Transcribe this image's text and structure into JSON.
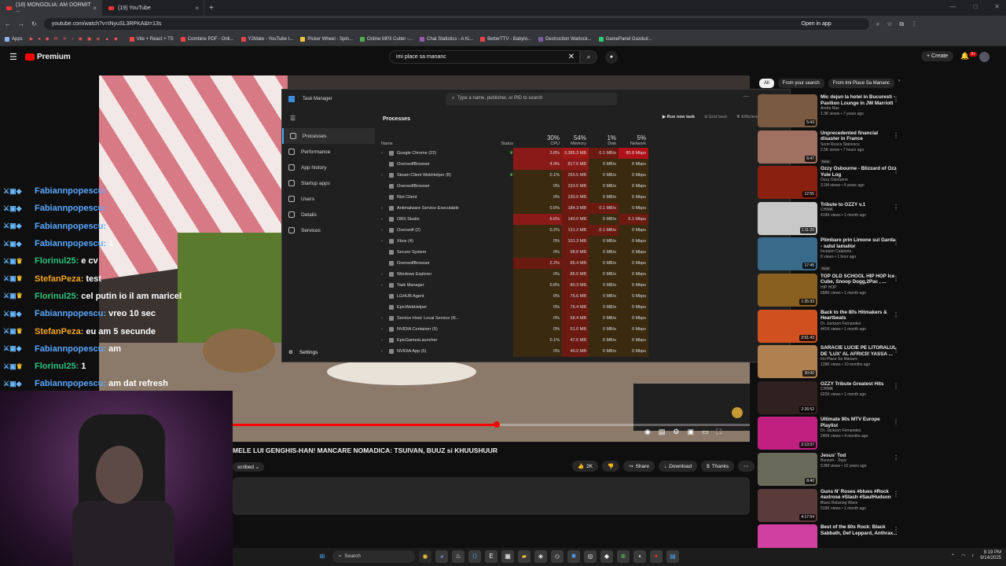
{
  "browser": {
    "tabs": [
      {
        "title": "(18) MONGOLIA: AM DORMIT ..."
      },
      {
        "title": "(19) YouTube"
      }
    ],
    "url": "youtube.com/watch?v=tNyuSL3RPKA&t=13s",
    "open_in_app": "Open in app",
    "bookmarks": [
      "Apps",
      "Vite + React + TS",
      "Combine PDF - Onli...",
      "Y2Mate - YouTube t...",
      "Picker Wheel - Spin...",
      "Online MP3 Cutter -...",
      "Chat Statistics - A Ki...",
      "BetterTTV - Babylo...",
      "Destruction Warlock...",
      "GamePanel Gazduir..."
    ]
  },
  "youtube": {
    "logo": "Premium",
    "search_value": "imi place sa mananc",
    "create_label": "Create",
    "notif_count": "9+",
    "video_title": "MELE LUI GENGHIS-HAN! MANCARE NOMADICA: TSUIVAN, BUUZ si KHUUSHUUR",
    "subscribed": "scribed",
    "likes": "2K",
    "share": "Share",
    "download": "Download",
    "thanks": "Thanks",
    "progress": 0.51,
    "filters": [
      "All",
      "From your search",
      "From Imi Place Sa Mananc"
    ],
    "recommendations": [
      {
        "title": "Mic dejun la hotel in Bucuresti - Pavilion Lounge in JW Marriott",
        "channel": "Andra Ras",
        "meta": "1.3K views • 7 years ago",
        "duration": "5:43",
        "badge": "",
        "color": "#7a5a40"
      },
      {
        "title": "Unprecedented financial disaster in France",
        "channel": "Sorin Rosca Stanescu",
        "meta": "2.5K views • 7 hours ago",
        "duration": "6:47",
        "badge": "New",
        "color": "#a07060"
      },
      {
        "title": "Ozzy Osbourne - Blizzard of Ozz Yule Log",
        "channel": "Ozzy Osbourne",
        "meta": "3.2M views • 4 years ago",
        "duration": "12:55",
        "badge": "",
        "color": "#8a2010"
      },
      {
        "title": "Tribute to OZZY v.1",
        "channel": "CHIMK",
        "meta": "419K views • 1 month ago",
        "duration": "1:11:20",
        "badge": "",
        "color": "#c8c8c8"
      },
      {
        "title": "Plimbare prin Limone sul Garda - satul lamailor",
        "channel": "Inceperi Calatoria",
        "meta": "8 views • 1 hour ago",
        "duration": "17:45",
        "badge": "New",
        "color": "#3a6a8a"
      },
      {
        "title": "TOP OLD SCHOOL HIP HOP Ice Cube, Snoop Dogg,2Pac , ...",
        "channel": "HIP HOP",
        "meta": "658K views • 1 month ago",
        "duration": "1:35:33",
        "badge": "",
        "color": "#8a6020"
      },
      {
        "title": "Back to the 80s Hitmakers & Heartbeats",
        "channel": "Dr. Jackson Fernandes",
        "meta": "441K views • 1 month ago",
        "duration": "2:51:43",
        "badge": "",
        "color": "#d05020"
      },
      {
        "title": "SARACIE LUCIE PE LITORALUL DE 'LUX' AL AFRICII! YASSA ...",
        "channel": "Imi Place Sa Mananc",
        "meta": "128K views • 10 months ago",
        "duration": "30:00",
        "badge": "",
        "color": "#b08050"
      },
      {
        "title": "OZZY Tribute Greatest Hits",
        "channel": "CHIMK",
        "meta": "622K views • 1 month ago",
        "duration": "2:26:52",
        "badge": "",
        "color": "#302020"
      },
      {
        "title": "Ultimate 90s MTV Europe Playlist",
        "channel": "Dr. Jackson Fernandes",
        "meta": "240K views • 4 months ago",
        "duration": "2:13:37",
        "badge": "",
        "color": "#c02080"
      },
      {
        "title": "Jesus' Tod",
        "channel": "Burzum - Topic",
        "meta": "5.8M views • 10 years ago",
        "duration": "8:40",
        "badge": "",
        "color": "#6a6a5a"
      },
      {
        "title": "Guns N' Roses #blues #Rock #axlrose #Slash #SaulHudson",
        "channel": "Blues Relaxing Wave",
        "meta": "519K views • 1 month ago",
        "duration": "4:17:54",
        "badge": "",
        "color": "#5a3a3a"
      },
      {
        "title": "Best of the 80s Rock: Black Sabbath, Def Leppard, Anthrax...",
        "channel": "",
        "meta": "",
        "duration": "",
        "badge": "",
        "color": "#d040a0"
      }
    ]
  },
  "task_manager": {
    "title": "Task Manager",
    "search_placeholder": "Type a name, publisher, or PID to search",
    "nav": [
      "Processes",
      "Performance",
      "App history",
      "Startup apps",
      "Users",
      "Details",
      "Services"
    ],
    "settings": "Settings",
    "section": "Processes",
    "run_new_task": "Run new task",
    "end_task": "End task",
    "efficiency_mode": "Efficiency mode",
    "columns": {
      "name": "Name",
      "status": "Status",
      "cpu_pct": "30%",
      "cpu": "CPU",
      "mem_pct": "54%",
      "mem": "Memory",
      "disk_pct": "1%",
      "disk": "Disk",
      "net_pct": "5%",
      "net": "Network"
    },
    "rows": [
      {
        "name": "Google Chrome (22)",
        "exp": true,
        "status": "leaf",
        "cpu": "3.8%",
        "mem": "3,385.3 MB",
        "disk": "0.1 MB/s",
        "net": "80.8 Mbps",
        "heat": [
          3,
          4,
          2,
          5
        ]
      },
      {
        "name": "OverwolfBrowser",
        "exp": false,
        "status": "",
        "cpu": "4.9%",
        "mem": "817.6 MB",
        "disk": "0 MB/s",
        "net": "0 Mbps",
        "heat": [
          3,
          3,
          1,
          1
        ]
      },
      {
        "name": "Steam Client WebHelper (8)",
        "exp": true,
        "status": "leaf",
        "cpu": "0.1%",
        "mem": "255.5 MB",
        "disk": "0 MB/s",
        "net": "0 Mbps",
        "heat": [
          1,
          2,
          1,
          1
        ]
      },
      {
        "name": "OverwolfBrowser",
        "exp": false,
        "status": "",
        "cpu": "0%",
        "mem": "233.0 MB",
        "disk": "0 MB/s",
        "net": "0 Mbps",
        "heat": [
          1,
          2,
          1,
          1
        ]
      },
      {
        "name": "Riot Client",
        "exp": false,
        "status": "",
        "cpu": "0%",
        "mem": "230.0 MB",
        "disk": "0 MB/s",
        "net": "0 Mbps",
        "heat": [
          1,
          2,
          1,
          1
        ]
      },
      {
        "name": "Antimalware Service Executable",
        "exp": true,
        "status": "",
        "cpu": "0.5%",
        "mem": "184.3 MB",
        "disk": "0.1 MB/s",
        "net": "0 Mbps",
        "heat": [
          1,
          2,
          2,
          1
        ]
      },
      {
        "name": "OBS Studio",
        "exp": true,
        "status": "",
        "cpu": "6.6%",
        "mem": "140.0 MB",
        "disk": "0 MB/s",
        "net": "6.1 Mbps",
        "heat": [
          3,
          2,
          1,
          2
        ]
      },
      {
        "name": "Overwolf (2)",
        "exp": true,
        "status": "",
        "cpu": "0.2%",
        "mem": "131.2 MB",
        "disk": "0.1 MB/s",
        "net": "0 Mbps",
        "heat": [
          1,
          2,
          2,
          1
        ]
      },
      {
        "name": "Xbox (4)",
        "exp": true,
        "status": "",
        "cpu": "0%",
        "mem": "101.3 MB",
        "disk": "0 MB/s",
        "net": "0 Mbps",
        "heat": [
          1,
          2,
          1,
          1
        ]
      },
      {
        "name": "Secure System",
        "exp": false,
        "status": "",
        "cpu": "0%",
        "mem": "98.8 MB",
        "disk": "0 MB/s",
        "net": "0 Mbps",
        "heat": [
          1,
          2,
          1,
          1
        ]
      },
      {
        "name": "OverwolfBrowser",
        "exp": false,
        "status": "",
        "cpu": "2.2%",
        "mem": "85.4 MB",
        "disk": "0 MB/s",
        "net": "0 Mbps",
        "heat": [
          2,
          2,
          1,
          1
        ]
      },
      {
        "name": "Windows Explorer",
        "exp": true,
        "status": "",
        "cpu": "0%",
        "mem": "85.0 MB",
        "disk": "0 MB/s",
        "net": "0 Mbps",
        "heat": [
          1,
          2,
          1,
          1
        ]
      },
      {
        "name": "Task Manager",
        "exp": true,
        "status": "",
        "cpu": "0.8%",
        "mem": "80.3 MB",
        "disk": "0 MB/s",
        "net": "0 Mbps",
        "heat": [
          1,
          2,
          1,
          1
        ]
      },
      {
        "name": "LGHUB Agent",
        "exp": false,
        "status": "",
        "cpu": "0%",
        "mem": "76.6 MB",
        "disk": "0 MB/s",
        "net": "0 Mbps",
        "heat": [
          1,
          2,
          1,
          1
        ]
      },
      {
        "name": "EpicWebHelper",
        "exp": false,
        "status": "",
        "cpu": "0%",
        "mem": "76.4 MB",
        "disk": "0 MB/s",
        "net": "0 Mbps",
        "heat": [
          1,
          2,
          1,
          1
        ]
      },
      {
        "name": "Service Host: Local Service (N...",
        "exp": true,
        "status": "",
        "cpu": "0%",
        "mem": "58.4 MB",
        "disk": "0 MB/s",
        "net": "0 Mbps",
        "heat": [
          1,
          2,
          1,
          1
        ]
      },
      {
        "name": "NVIDIA Container (5)",
        "exp": true,
        "status": "",
        "cpu": "0%",
        "mem": "51.0 MB",
        "disk": "0 MB/s",
        "net": "0 Mbps",
        "heat": [
          1,
          2,
          1,
          1
        ]
      },
      {
        "name": "EpicGamesLauncher",
        "exp": true,
        "status": "",
        "cpu": "0.1%",
        "mem": "47.6 MB",
        "disk": "0 MB/s",
        "net": "0 Mbps",
        "heat": [
          1,
          2,
          1,
          1
        ]
      },
      {
        "name": "NVIDIA App (5)",
        "exp": true,
        "status": "",
        "cpu": "0%",
        "mem": "40.0 MB",
        "disk": "0 MB/s",
        "net": "0 Mbps",
        "heat": [
          1,
          2,
          1,
          1
        ]
      }
    ]
  },
  "chat": [
    {
      "user": "Fabiannpopescu",
      "text": "",
      "color": "#5aa8ff",
      "badge": "sword"
    },
    {
      "user": "Fabiannpopescu",
      "text": "",
      "color": "#5aa8ff",
      "badge": "sword"
    },
    {
      "user": "Fabiannpopescu",
      "text": "",
      "color": "#5aa8ff",
      "badge": "sword"
    },
    {
      "user": "Fabiannpopescu",
      "text": "1",
      "color": "#5aa8ff",
      "badge": "sword"
    },
    {
      "user": "Florinul25",
      "text": "e cv",
      "color": "#2ec27e",
      "badge": "crown"
    },
    {
      "user": "StefanPeza",
      "text": "test",
      "color": "#f5a623",
      "badge": "crown"
    },
    {
      "user": "Florinul25",
      "text": "cel putin io il am maricel",
      "color": "#2ec27e",
      "badge": "crown"
    },
    {
      "user": "Fabiannpopescu",
      "text": "vreo 10 sec",
      "color": "#5aa8ff",
      "badge": "sword"
    },
    {
      "user": "StefanPeza",
      "text": "eu am 5 secunde",
      "color": "#f5a623",
      "badge": "crown"
    },
    {
      "user": "Fabiannpopescu",
      "text": "am",
      "color": "#5aa8ff",
      "badge": "sword"
    },
    {
      "user": "Florinul25",
      "text": "1",
      "color": "#2ec27e",
      "badge": "crown"
    },
    {
      "user": "Fabiannpopescu",
      "text": "am dat refresh",
      "color": "#5aa8ff",
      "badge": "sword"
    }
  ],
  "taskbar": {
    "search": "Search",
    "time": "8:19 PM",
    "date": "9/14/2025"
  }
}
